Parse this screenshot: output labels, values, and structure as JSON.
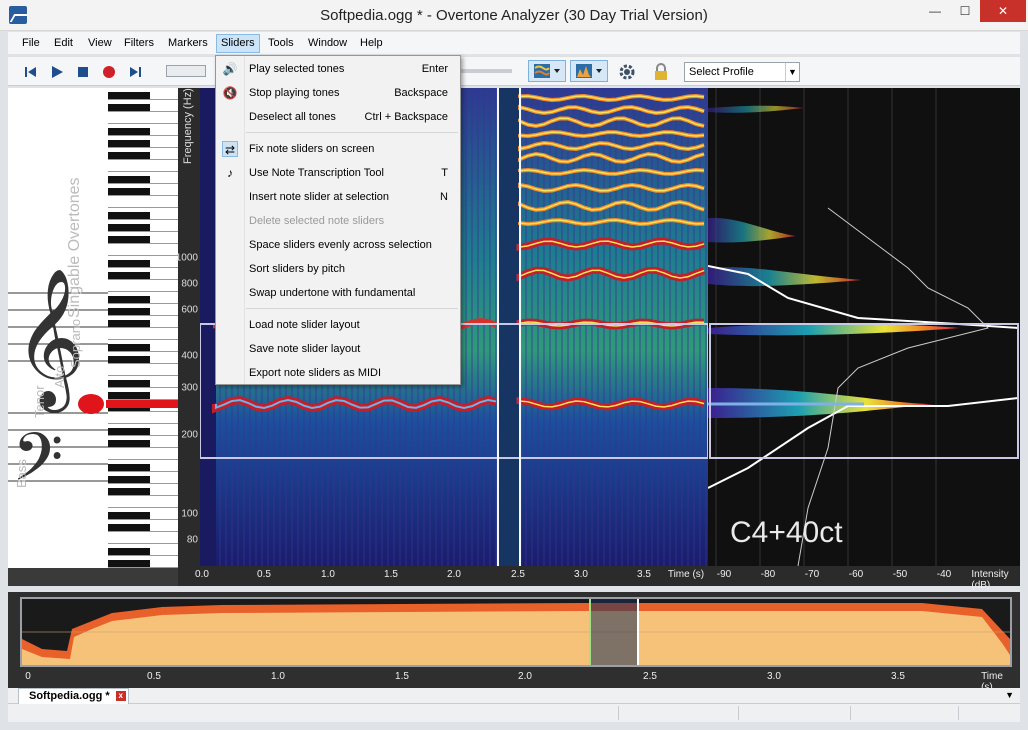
{
  "window": {
    "title": "Softpedia.ogg * - Overtone Analyzer (30 Day Trial Version)",
    "minimize": "—",
    "maximize": "☐",
    "close": "✕"
  },
  "menubar": [
    "File",
    "Edit",
    "View",
    "Filters",
    "Markers",
    "Sliders",
    "Tools",
    "Window",
    "Help"
  ],
  "toolbar": {
    "select_profile": "Select Profile"
  },
  "sliders_menu": {
    "items": [
      {
        "label": "Play selected tones",
        "shortcut": "Enter",
        "icon": "speaker-icon"
      },
      {
        "label": "Stop playing tones",
        "shortcut": "Backspace",
        "icon": "mute-speaker-icon"
      },
      {
        "label": "Deselect all tones",
        "shortcut": "Ctrl + Backspace",
        "icon": ""
      },
      {
        "label": "Fix note sliders on screen",
        "shortcut": "",
        "icon": "swap-arrows-icon"
      },
      {
        "label": "Use Note Transcription Tool",
        "shortcut": "T",
        "icon": "note-cursor-icon"
      },
      {
        "label": "Insert note slider at selection",
        "shortcut": "N",
        "icon": ""
      },
      {
        "label": "Delete selected note sliders",
        "shortcut": "",
        "icon": "",
        "disabled": true
      },
      {
        "label": "Space sliders evenly across selection",
        "shortcut": "",
        "icon": ""
      },
      {
        "label": "Sort sliders by pitch",
        "shortcut": "",
        "icon": ""
      },
      {
        "label": "Swap undertone with fundamental",
        "shortcut": "",
        "icon": ""
      },
      {
        "label": "Load note slider layout",
        "shortcut": "",
        "icon": ""
      },
      {
        "label": "Save note slider layout",
        "shortcut": "",
        "icon": ""
      },
      {
        "label": "Export note sliders as MIDI",
        "shortcut": "",
        "icon": ""
      }
    ]
  },
  "piano_panel": {
    "labels": [
      "Singable Overtones",
      "Soprano",
      "Alto",
      "Tenor",
      "Bass"
    ]
  },
  "spectrogram": {
    "y_axis_label": "Frequency (Hz)",
    "y_ticks": [
      "1000",
      "800",
      "600",
      "400",
      "300",
      "200",
      "100",
      "80"
    ],
    "x_ticks": [
      "0.0",
      "0.5",
      "1.0",
      "1.5",
      "2.0",
      "2.5",
      "3.0",
      "3.5"
    ],
    "x_label": "Time (s)"
  },
  "intensity": {
    "x_ticks": [
      "-90",
      "-80",
      "-70",
      "-60",
      "-50",
      "-40"
    ],
    "x_label": "Intensity (dB)",
    "note": "C4+40ct"
  },
  "overview": {
    "x_ticks": [
      "0",
      "0.5",
      "1.0",
      "1.5",
      "2.0",
      "2.5",
      "3.0",
      "3.5"
    ],
    "x_label": "Time (s)"
  },
  "tabs": {
    "file_tab": "Softpedia.ogg *",
    "close": "x"
  },
  "colors": {
    "accent": "#cce4f7",
    "close_red": "#c7312a",
    "overview_fill": "#f6c27a",
    "overview_edge": "#e8602a"
  }
}
